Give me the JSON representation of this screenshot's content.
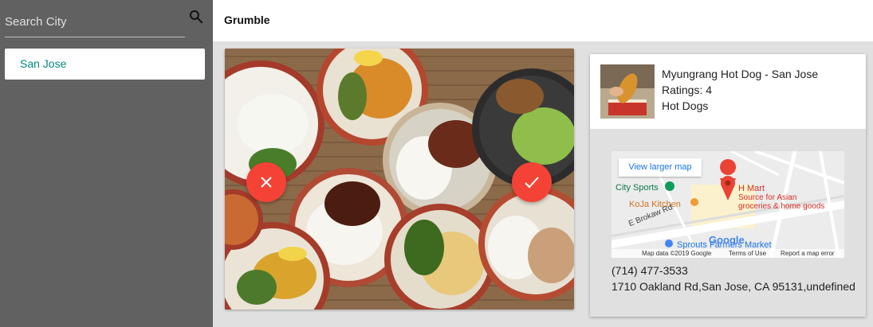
{
  "sidebar": {
    "search": {
      "placeholder": "Search City",
      "value": ""
    },
    "search_icon": "search-icon",
    "cities": [
      {
        "label": "San Jose"
      }
    ]
  },
  "header": {
    "title": "Grumble"
  },
  "food_card": {
    "reject_icon": "close-icon",
    "accept_icon": "check-icon",
    "button_color": "#f44336"
  },
  "restaurant": {
    "name": "Myungrang Hot Dog - San Jose",
    "ratings": "Ratings: 4",
    "category": "Hot Dogs",
    "phone": "(714) 477-3533",
    "address": "1710 Oakland Rd,San Jose, CA 95131,undefined"
  },
  "map": {
    "larger_map_link": "View larger map",
    "labels": {
      "city_sports": "City Sports",
      "koja_kitchen": "KoJa Kitchen",
      "hmart": "H Mart",
      "hmart_desc_1": "Source for Asian",
      "hmart_desc_2": "groceries & home goods",
      "brokaw": "E Brokaw Rd",
      "sprouts": "Sprouts Farmers Market",
      "google": "Google"
    },
    "footer": {
      "map_data": "Map data ©2019 Google",
      "terms": "Terms of Use",
      "report": "Report a map error"
    }
  },
  "colors": {
    "accent": "#00897b",
    "sidebar": "#616161",
    "action": "#f44336"
  }
}
